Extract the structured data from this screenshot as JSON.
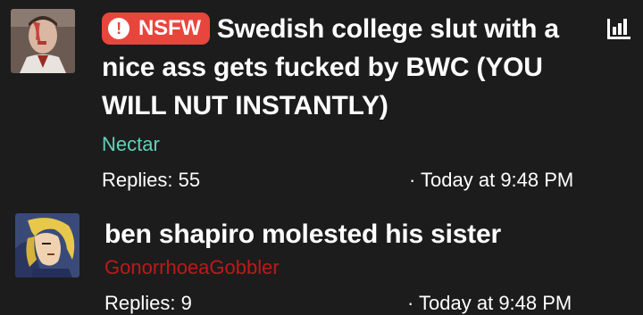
{
  "threads": [
    {
      "badge_label": "NSFW",
      "badge_icon": "exclamation-icon",
      "title": "Swedish college slut with a nice ass gets fucked by BWC (YOU WILL NUT INSTANTLY)",
      "author": "Nectar",
      "author_color": "#5fd3b8",
      "replies_label": "Replies: 55",
      "time_label": "· Today at 9:48 PM"
    },
    {
      "title": "ben shapiro molested his sister",
      "author": "GonorrhoeaGobbler",
      "author_color": "#c0181a",
      "replies_label": "Replies: 9",
      "time_label": "· Today at 9:48 PM"
    }
  ],
  "colors": {
    "background": "#1c1c1c",
    "badge": "#e8453c"
  },
  "icons": {
    "poll": "bar-chart-icon"
  }
}
